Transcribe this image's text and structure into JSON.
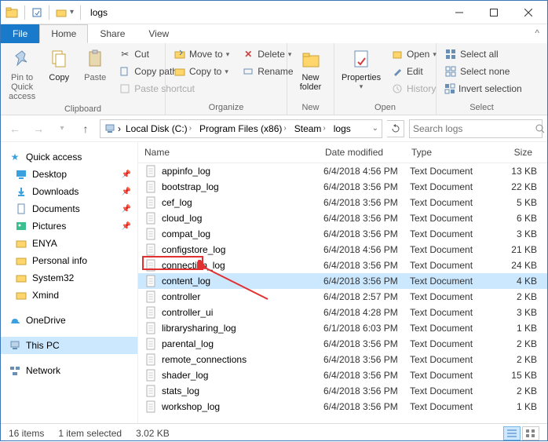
{
  "window": {
    "title": "logs"
  },
  "tabs": {
    "file": "File",
    "home": "Home",
    "share": "Share",
    "view": "View"
  },
  "ribbon": {
    "clipboard": {
      "label": "Clipboard",
      "pin": "Pin to Quick\naccess",
      "copy": "Copy",
      "paste": "Paste",
      "cut": "Cut",
      "copy_path": "Copy path",
      "paste_shortcut": "Paste shortcut"
    },
    "organize": {
      "label": "Organize",
      "move_to": "Move to",
      "copy_to": "Copy to",
      "delete": "Delete",
      "rename": "Rename"
    },
    "new": {
      "label": "New",
      "new_folder": "New\nfolder"
    },
    "open": {
      "label": "Open",
      "properties": "Properties",
      "open": "Open",
      "edit": "Edit",
      "history": "History"
    },
    "select": {
      "label": "Select",
      "select_all": "Select all",
      "select_none": "Select none",
      "invert": "Invert selection"
    }
  },
  "breadcrumb": {
    "parts": [
      "Local Disk (C:)",
      "Program Files (x86)",
      "Steam",
      "logs"
    ]
  },
  "search": {
    "placeholder": "Search logs"
  },
  "nav": {
    "quick_access": "Quick access",
    "desktop": "Desktop",
    "downloads": "Downloads",
    "documents": "Documents",
    "pictures": "Pictures",
    "enya": "ENYA",
    "personal": "Personal info",
    "system32": "System32",
    "xmind": "Xmind",
    "onedrive": "OneDrive",
    "this_pc": "This PC",
    "network": "Network"
  },
  "columns": {
    "name": "Name",
    "date": "Date modified",
    "type": "Type",
    "size": "Size"
  },
  "files": [
    {
      "name": "appinfo_log",
      "date": "6/4/2018 4:56 PM",
      "type": "Text Document",
      "size": "13 KB"
    },
    {
      "name": "bootstrap_log",
      "date": "6/4/2018 3:56 PM",
      "type": "Text Document",
      "size": "22 KB"
    },
    {
      "name": "cef_log",
      "date": "6/4/2018 3:56 PM",
      "type": "Text Document",
      "size": "5 KB"
    },
    {
      "name": "cloud_log",
      "date": "6/4/2018 3:56 PM",
      "type": "Text Document",
      "size": "6 KB"
    },
    {
      "name": "compat_log",
      "date": "6/4/2018 3:56 PM",
      "type": "Text Document",
      "size": "3 KB"
    },
    {
      "name": "configstore_log",
      "date": "6/4/2018 4:56 PM",
      "type": "Text Document",
      "size": "21 KB"
    },
    {
      "name": "connection_log",
      "date": "6/4/2018 3:56 PM",
      "type": "Text Document",
      "size": "24 KB"
    },
    {
      "name": "content_log",
      "date": "6/4/2018 3:56 PM",
      "type": "Text Document",
      "size": "4 KB",
      "selected": true
    },
    {
      "name": "controller",
      "date": "6/4/2018 2:57 PM",
      "type": "Text Document",
      "size": "2 KB"
    },
    {
      "name": "controller_ui",
      "date": "6/4/2018 4:28 PM",
      "type": "Text Document",
      "size": "3 KB"
    },
    {
      "name": "librarysharing_log",
      "date": "6/1/2018 6:03 PM",
      "type": "Text Document",
      "size": "1 KB"
    },
    {
      "name": "parental_log",
      "date": "6/4/2018 3:56 PM",
      "type": "Text Document",
      "size": "2 KB"
    },
    {
      "name": "remote_connections",
      "date": "6/4/2018 3:56 PM",
      "type": "Text Document",
      "size": "2 KB"
    },
    {
      "name": "shader_log",
      "date": "6/4/2018 3:56 PM",
      "type": "Text Document",
      "size": "15 KB"
    },
    {
      "name": "stats_log",
      "date": "6/4/2018 3:56 PM",
      "type": "Text Document",
      "size": "2 KB"
    },
    {
      "name": "workshop_log",
      "date": "6/4/2018 3:56 PM",
      "type": "Text Document",
      "size": "1 KB"
    }
  ],
  "status": {
    "count": "16 items",
    "selected": "1 item selected",
    "size": "3.02 KB"
  }
}
